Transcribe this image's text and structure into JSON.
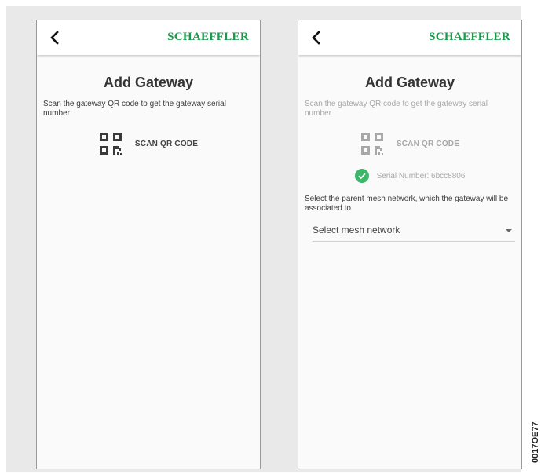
{
  "screens": [
    {
      "brand": "SCHAEFFLER",
      "title": "Add Gateway",
      "instruction": "Scan the gateway QR code to get the gateway serial number",
      "scan_label": "SCAN QR CODE"
    },
    {
      "brand": "SCHAEFFLER",
      "title": "Add Gateway",
      "instruction": "Scan the gateway QR code to get the gateway serial number",
      "scan_label": "SCAN QR CODE",
      "serial": "Serial Number: 6bcc8806",
      "parent_instruction": "Select the parent mesh network, which the gateway will be associated to",
      "select_placeholder": "Select mesh network"
    }
  ],
  "figure_code": "0017OE77",
  "colors": {
    "brand_green": "#1a9a4a",
    "check_green": "#3cb76a",
    "frame_bg": "#e9e9e9"
  },
  "icons": [
    "back-arrow-icon",
    "qr-code-icon",
    "check-circle-icon",
    "dropdown-caret-icon"
  ]
}
